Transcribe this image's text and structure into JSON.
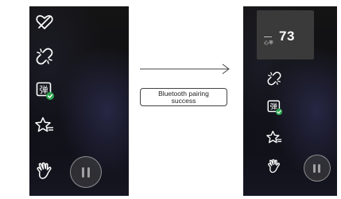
{
  "toast": {
    "line1": "Bluetooth pairing",
    "line2": "success"
  },
  "heart_rate": {
    "label": "心率",
    "value": "73"
  },
  "icons": [
    "heart-off-icon",
    "link-broken-icon",
    "danmaku-icon",
    "star-icon",
    "hand-icon",
    "pause-icon"
  ],
  "colors": {
    "background": "#0d0d12",
    "danmaku_badge": "#2ea44f",
    "card": "#3a3a3a",
    "icon": "#ffffff"
  }
}
